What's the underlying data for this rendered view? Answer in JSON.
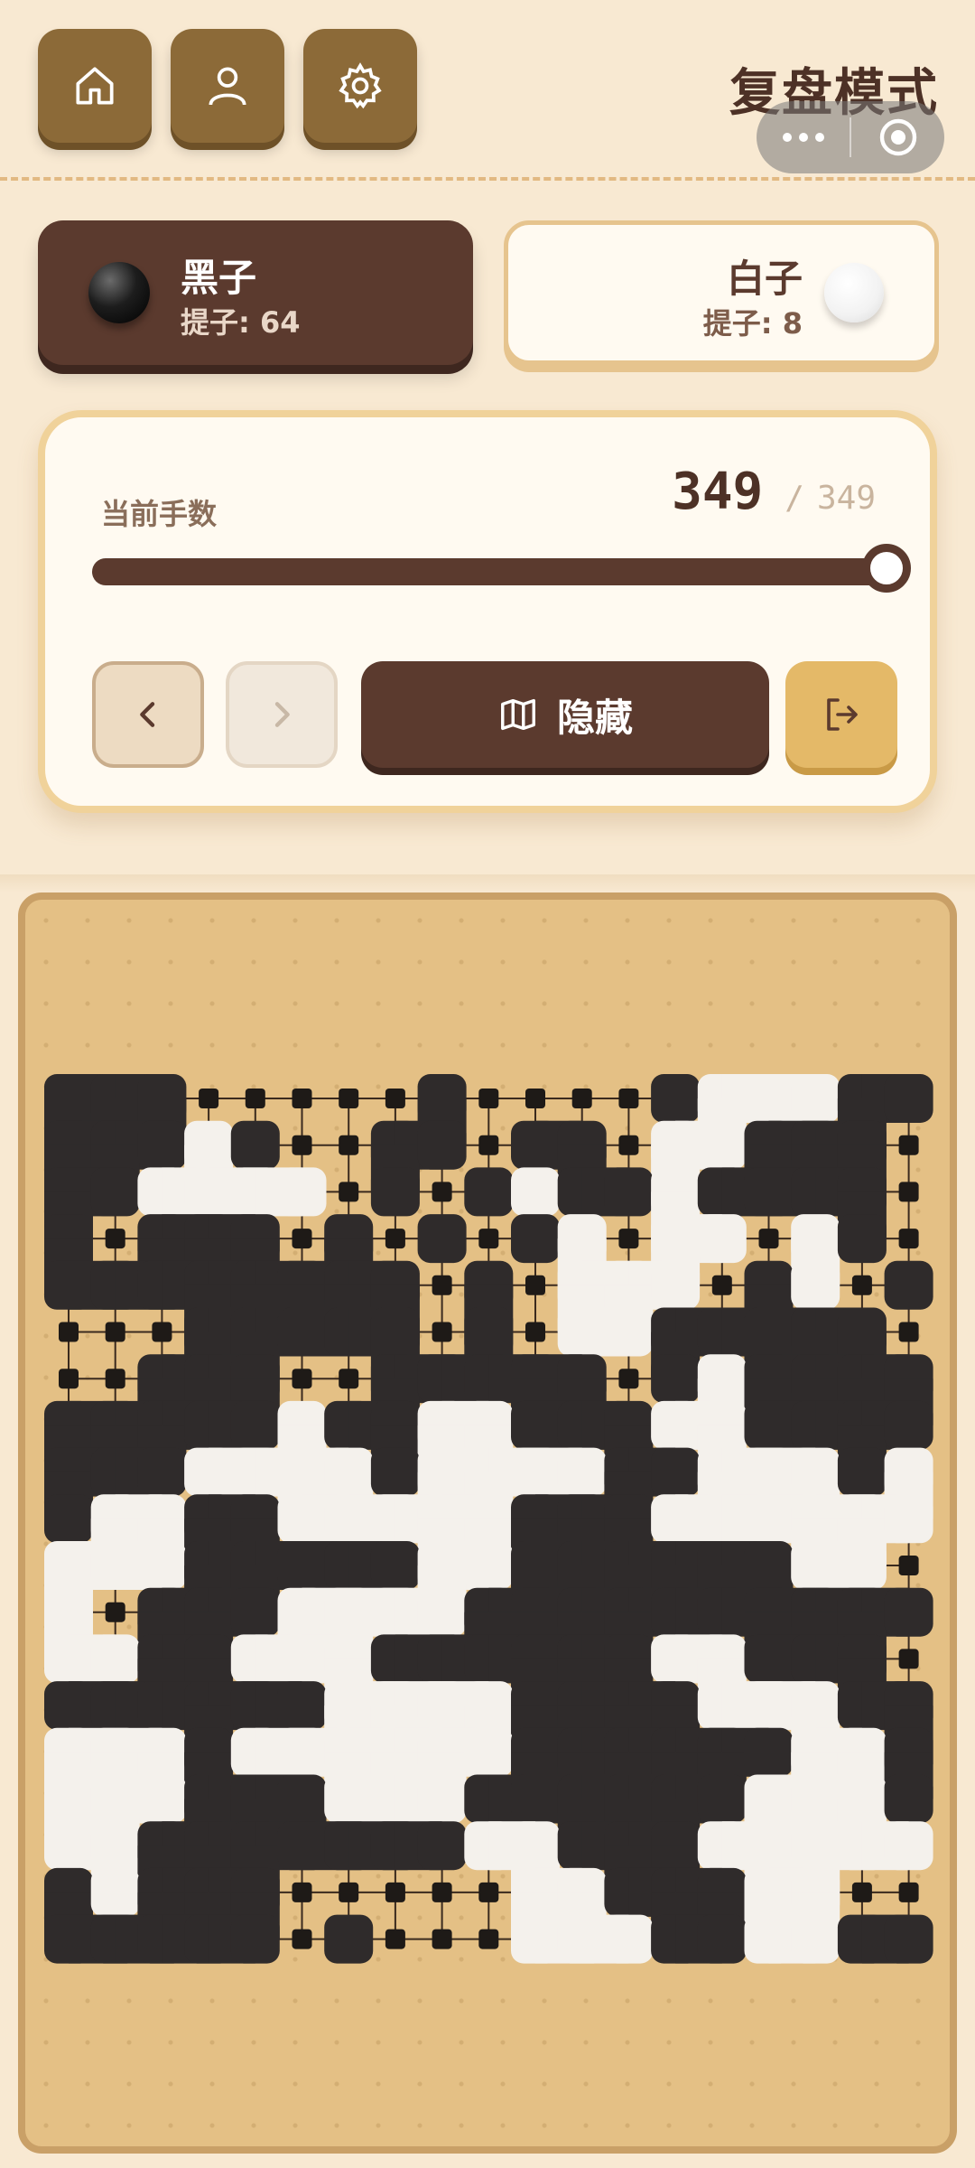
{
  "header": {
    "title": "复盘模式",
    "buttons": [
      {
        "name": "home-button",
        "icon": "home-icon"
      },
      {
        "name": "profile-button",
        "icon": "user-icon"
      },
      {
        "name": "settings-button",
        "icon": "gear-icon"
      }
    ],
    "capsule": {
      "more": "more-icon",
      "close": "target-icon"
    }
  },
  "players": {
    "black": {
      "name": "黑子",
      "captures": "提子: 64"
    },
    "white": {
      "name": "白子",
      "captures": "提子: 8"
    }
  },
  "moves": {
    "label": "当前手数",
    "current": "349",
    "separator": "/",
    "total": "349",
    "progress": 1.0
  },
  "controls": {
    "prev_icon": "chevron-left-icon",
    "next_icon": "chevron-right-icon",
    "toggle_label": "隐藏",
    "toggle_icon": "map-icon",
    "exit_icon": "exit-icon"
  },
  "board": {
    "size": 19,
    "colors": {
      "black": "#2f2b2b",
      "white": "#f4f1ec",
      "wood": "#e4c085",
      "line": "#3a2a1e"
    },
    "rows": [
      "BBB.....B....BWWWBBB",
      "BBBWB..BB.BB.WWBBB.",
      "BBWWWW.B.BWBBWBBBB.",
      "B.BBB.B.B.BW.WW.WB.",
      "BBBBBBBB.B.WWW.BW.B",
      "...BBBBB.B.WWBBBBB.",
      "..BBB..BBBBB.BWBBBB",
      "BBBBBWBBWWBBBWWBBBB",
      "BBBWWWWBWWWWBBWWWBW",
      "BWWBBWWWWWBBBWWWWWW",
      "WWWBBBBBWWBBBBBBWW.",
      "W.BBBWWWWBBBBBBBBBB",
      "WWBBWWWBBBBBBWWBBB.",
      "BBBBBBWWWWBBBBWWWBB",
      "WWWBWWWWWWBBBBBBWWB",
      "WWWBBBWWWBBBBBBWWWB",
      "WWBBBBBBBWWBBBWWWWW",
      "BWBBB.....WWBBBWW..",
      "BBBBB.B...WWWBBWWBB"
    ]
  }
}
